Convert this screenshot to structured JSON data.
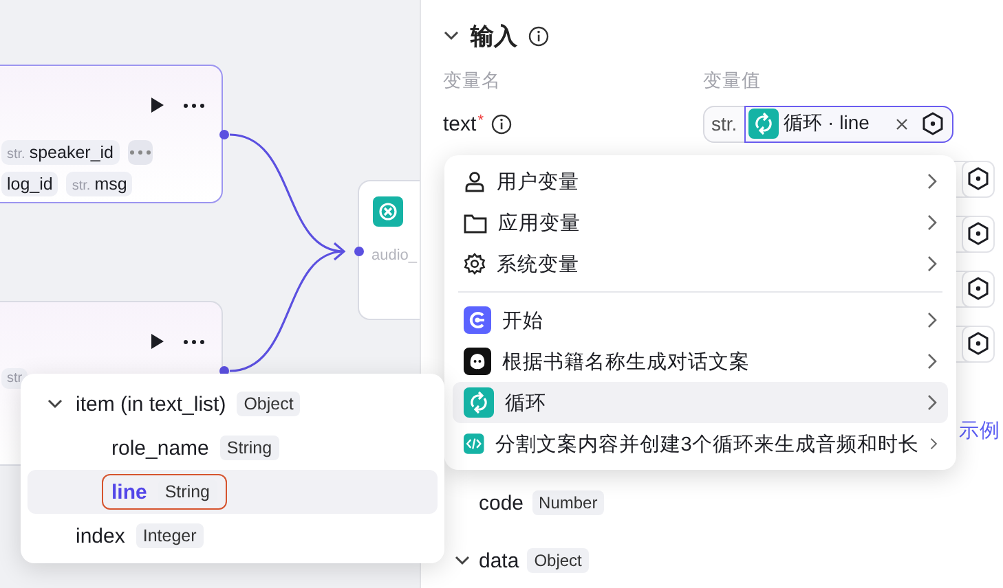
{
  "canvas": {
    "node_top": {
      "tags": [
        {
          "type": "str.",
          "name": "speaker_id"
        },
        {
          "name": "log_id"
        },
        {
          "type": "str.",
          "name": "msg"
        }
      ]
    },
    "node_bottom": {
      "tags": [
        {
          "type": "str"
        }
      ]
    },
    "node_right": {
      "field": "audio_"
    }
  },
  "input_section": {
    "title": "输入",
    "expanded": true,
    "columns": [
      "变量名",
      "变量值"
    ],
    "rows": [
      {
        "kind": "set",
        "name": "text",
        "required_mark": "*",
        "type": "str.",
        "value": "循环 · line"
      },
      {
        "kind": "empty"
      },
      {
        "kind": "empty"
      },
      {
        "kind": "empty"
      },
      {
        "kind": "empty"
      }
    ]
  },
  "example_link": "示例",
  "outputs": [
    {
      "name": "code",
      "type": "Number"
    },
    {
      "name": "data",
      "type": "Object",
      "expanded": true
    }
  ],
  "menu": {
    "items": [
      {
        "kind": "user",
        "label": "用户变量",
        "selected": false
      },
      {
        "kind": "app",
        "label": "应用变量",
        "selected": false
      },
      {
        "kind": "system",
        "label": "系统变量",
        "selected": false
      },
      {
        "kind": "start",
        "label": "开始",
        "selected": false
      },
      {
        "kind": "llm",
        "label": "根据书籍名称生成对话文案",
        "selected": false
      },
      {
        "kind": "loop",
        "label": "循环",
        "selected": true
      },
      {
        "kind": "code",
        "label": "分割文案内容并创建3个循环来生成音频和时长",
        "selected": false
      }
    ]
  },
  "tree": {
    "items": [
      {
        "label": "item (in text_list)",
        "type": "Object",
        "expanded": true,
        "selected": false,
        "children": [
          {
            "label": "role_name",
            "type": "String",
            "selected": false
          },
          {
            "label": "line",
            "type": "String",
            "selected": true
          }
        ]
      },
      {
        "label": "index",
        "type": "Integer",
        "selected": false
      }
    ]
  }
}
